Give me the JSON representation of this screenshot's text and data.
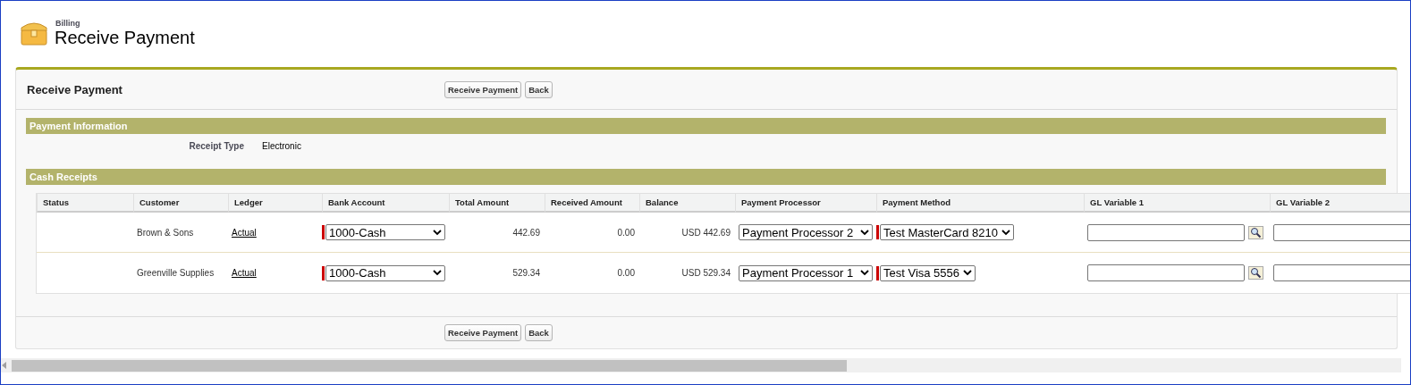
{
  "header": {
    "app": "Billing",
    "title": "Receive Payment"
  },
  "panel": {
    "title": "Receive Payment",
    "buttons": [
      "Receive Payment",
      "Back"
    ],
    "footer_buttons": [
      "Receive Payment",
      "Back"
    ]
  },
  "payment_information": {
    "title": "Payment Information",
    "fields": [
      {
        "label": "Receipt Type",
        "value": "Electronic"
      }
    ]
  },
  "cash_receipts": {
    "title": "Cash Receipts",
    "columns": [
      "Status",
      "Customer",
      "Ledger",
      "Bank Account",
      "Total Amount",
      "Received Amount",
      "Balance",
      "Payment Processor",
      "Payment Method",
      "GL Variable 1",
      "GL Variable 2"
    ],
    "rows": [
      {
        "customer": "Brown & Sons",
        "ledger": "Actual",
        "bank_account": {
          "value": "1000-Cash",
          "required": true
        },
        "total_amount": "442.69",
        "received_amount": "0.00",
        "balance": "USD 442.69",
        "payment_processor": {
          "value": "Payment Processor 2",
          "required": false
        },
        "payment_method": {
          "value": "Test MasterCard 8210",
          "required": true
        }
      },
      {
        "customer": "Greenville Supplies",
        "ledger": "Actual",
        "bank_account": {
          "value": "1000-Cash",
          "required": true
        },
        "total_amount": "529.34",
        "received_amount": "0.00",
        "balance": "USD 529.34",
        "payment_processor": {
          "value": "Payment Processor 1",
          "required": false
        },
        "payment_method": {
          "value": "Test Visa 5556",
          "required": true
        }
      }
    ]
  }
}
